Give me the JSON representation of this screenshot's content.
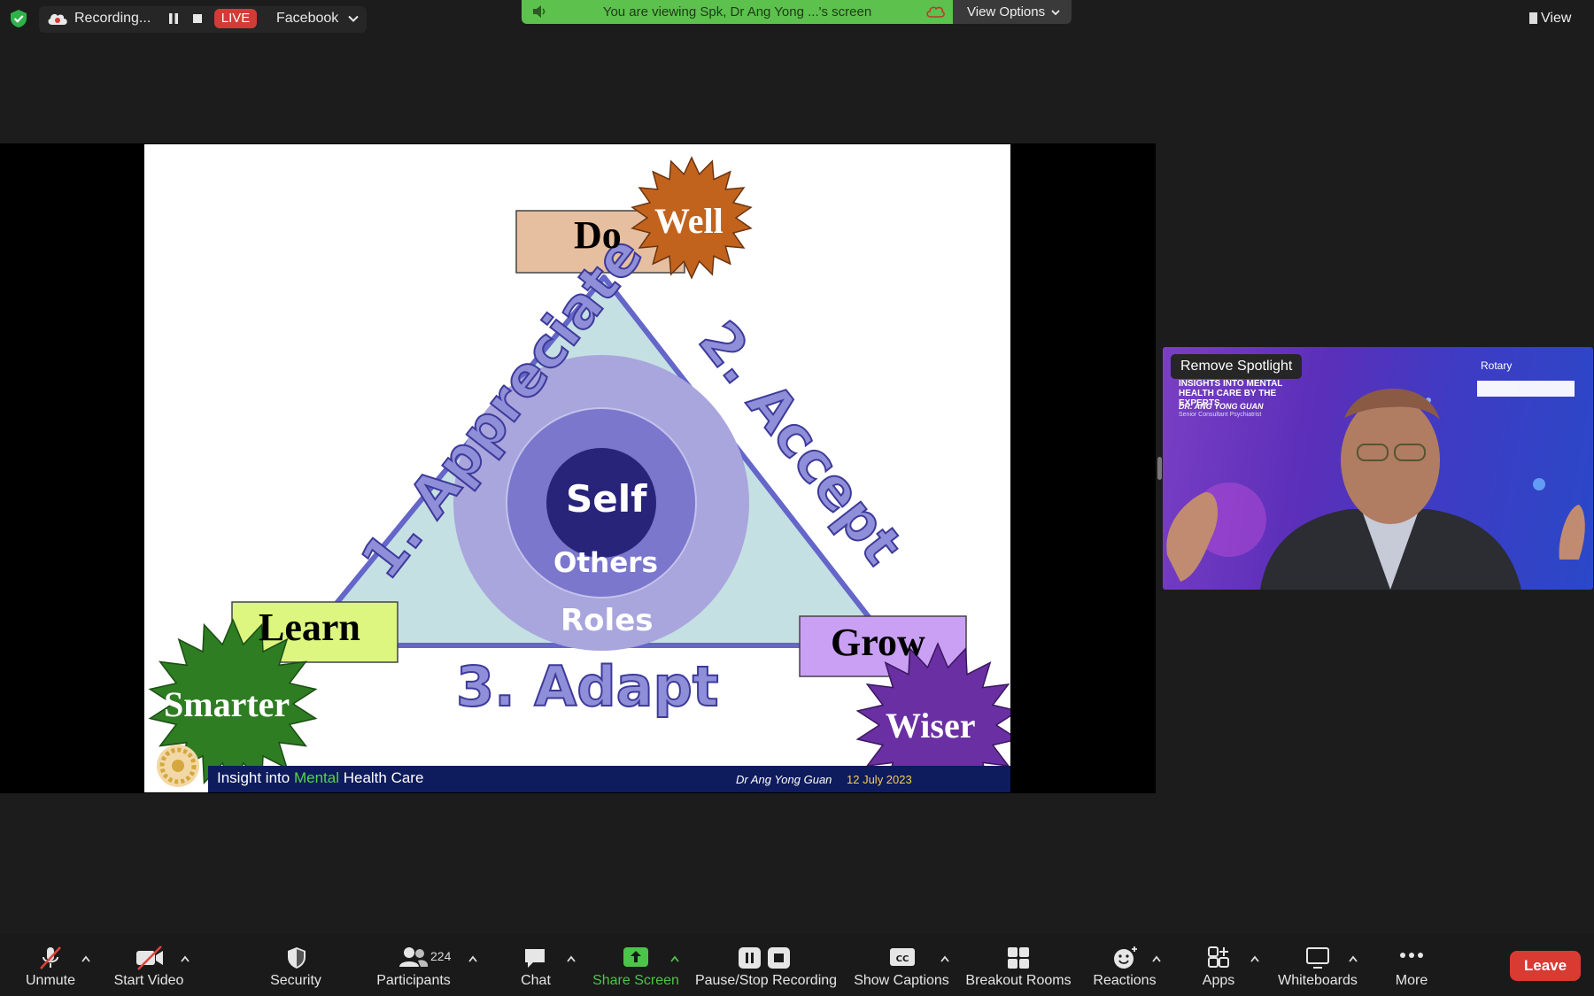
{
  "top_bar": {
    "recording_label": "Recording...",
    "live_badge": "LIVE",
    "stream_target": "Facebook",
    "viewing_banner": "You are viewing Spk, Dr Ang Yong ...'s screen",
    "view_options": "View Options",
    "view_button": "View"
  },
  "slide": {
    "do": "Do",
    "well": "Well",
    "appreciate": "1. Appreciate",
    "accept": "2. Accept",
    "adapt": "3. Adapt",
    "self": "Self",
    "others": "Others",
    "roles": "Roles",
    "learn": "Learn",
    "smarter": "Smarter",
    "grow": "Grow",
    "wiser": "Wiser",
    "footer_prefix": "Insight into ",
    "footer_highlight": "Mental",
    "footer_suffix": " Health Care",
    "footer_author": "Dr Ang Yong Guan",
    "footer_date": "12 July 2023"
  },
  "video": {
    "remove_spotlight": "Remove Spotlight",
    "org": "Rotary",
    "talk_title": "INSIGHTS INTO MENTAL HEALTH CARE BY THE EXPERTS",
    "doctor": "DR. ANG YONG GUAN",
    "role": "Senior Consultant Psychiatrist"
  },
  "toolbar": {
    "unmute": "Unmute",
    "start_video": "Start Video",
    "security": "Security",
    "participants": "Participants",
    "participants_count": "224",
    "chat": "Chat",
    "share_screen": "Share Screen",
    "pause_stop_recording": "Pause/Stop Recording",
    "show_captions": "Show Captions",
    "breakout_rooms": "Breakout Rooms",
    "reactions": "Reactions",
    "apps": "Apps",
    "whiteboards": "Whiteboards",
    "more": "More",
    "leave": "Leave"
  },
  "colors": {
    "live": "#d43a36",
    "banner": "#5cc14d",
    "share_accent": "#4cc349",
    "leave": "#d93a32"
  }
}
